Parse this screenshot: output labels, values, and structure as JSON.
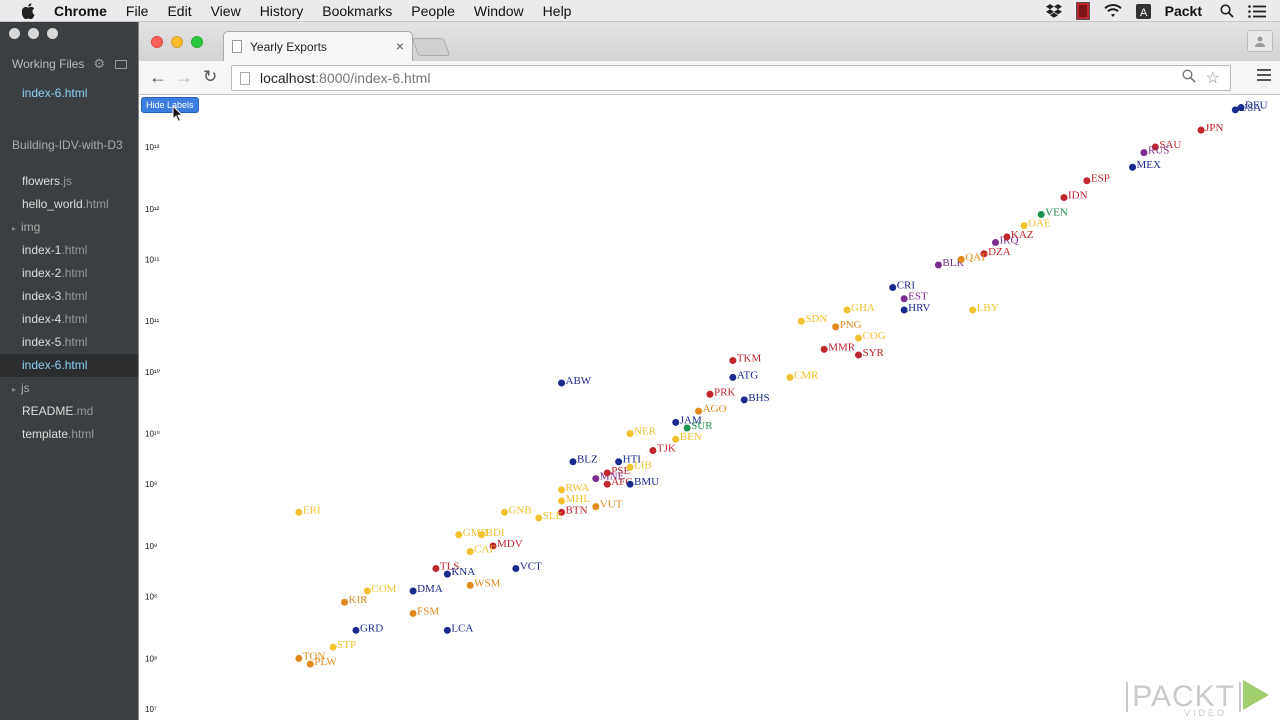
{
  "menubar": {
    "app": "Chrome",
    "items": [
      "File",
      "Edit",
      "View",
      "History",
      "Bookmarks",
      "People",
      "Window",
      "Help"
    ],
    "user": "Packt"
  },
  "editor": {
    "working_files_label": "Working Files",
    "working_file": "index-6.html",
    "project": "Building-IDV-with-D3",
    "tree": [
      {
        "name": "flowers",
        "ext": ".js",
        "type": "file"
      },
      {
        "name": "hello_world",
        "ext": ".html",
        "type": "file"
      },
      {
        "name": "img",
        "ext": "",
        "type": "folder"
      },
      {
        "name": "index-1",
        "ext": ".html",
        "type": "file"
      },
      {
        "name": "index-2",
        "ext": ".html",
        "type": "file"
      },
      {
        "name": "index-3",
        "ext": ".html",
        "type": "file"
      },
      {
        "name": "index-4",
        "ext": ".html",
        "type": "file"
      },
      {
        "name": "index-5",
        "ext": ".html",
        "type": "file"
      },
      {
        "name": "index-6",
        "ext": ".html",
        "type": "file",
        "active": true
      },
      {
        "name": "js",
        "ext": "",
        "type": "folder"
      },
      {
        "name": "README",
        "ext": ".md",
        "type": "file"
      },
      {
        "name": "template",
        "ext": ".html",
        "type": "file"
      }
    ]
  },
  "browser": {
    "tab_title": "Yearly Exports",
    "url_host": "localhost",
    "url_path": ":8000/index-6.html"
  },
  "page": {
    "hide_button": "Hide Labels"
  },
  "chart_data": {
    "type": "scatter",
    "y_scale": "log",
    "colors": [
      "#f2c12e",
      "#e08a1e",
      "#c0262d",
      "#7a2e8f",
      "#1a2a8c",
      "#1f8f4e"
    ],
    "y_ticks": [
      {
        "label": "10¹²",
        "v": 12.0
      },
      {
        "label": "10¹²",
        "v": 11.45
      },
      {
        "label": "10¹¹",
        "v": 11.0
      },
      {
        "label": "10¹¹",
        "v": 10.45
      },
      {
        "label": "10¹⁰",
        "v": 10.0
      },
      {
        "label": "10¹⁰",
        "v": 9.45
      },
      {
        "label": "10⁹",
        "v": 9.0
      },
      {
        "label": "10⁹",
        "v": 8.45
      },
      {
        "label": "10⁸",
        "v": 8.0
      },
      {
        "label": "10⁸",
        "v": 7.45
      },
      {
        "label": "10⁷",
        "v": 7.0
      }
    ],
    "points": [
      {
        "label": "DEU",
        "x": 0.965,
        "y": 12.35,
        "c": 4
      },
      {
        "label": "USA",
        "x": 0.96,
        "y": 12.33,
        "c": 4
      },
      {
        "label": "JPN",
        "x": 0.93,
        "y": 12.15,
        "c": 2
      },
      {
        "label": "SAU",
        "x": 0.89,
        "y": 12.0,
        "c": 2
      },
      {
        "label": "RUS",
        "x": 0.88,
        "y": 11.95,
        "c": 3
      },
      {
        "label": "MEX",
        "x": 0.87,
        "y": 11.82,
        "c": 4
      },
      {
        "label": "ESP",
        "x": 0.83,
        "y": 11.7,
        "c": 2
      },
      {
        "label": "IDN",
        "x": 0.81,
        "y": 11.55,
        "c": 2
      },
      {
        "label": "VEN",
        "x": 0.79,
        "y": 11.4,
        "c": 5
      },
      {
        "label": "OAE",
        "x": 0.775,
        "y": 11.3,
        "c": 0
      },
      {
        "label": "IRQ",
        "x": 0.75,
        "y": 11.15,
        "c": 3
      },
      {
        "label": "DZA",
        "x": 0.74,
        "y": 11.05,
        "c": 2
      },
      {
        "label": "KAZ",
        "x": 0.76,
        "y": 11.2,
        "c": 2
      },
      {
        "label": "BLR",
        "x": 0.7,
        "y": 10.95,
        "c": 3
      },
      {
        "label": "QAT",
        "x": 0.72,
        "y": 11.0,
        "c": 1
      },
      {
        "label": "EST",
        "x": 0.67,
        "y": 10.65,
        "c": 3
      },
      {
        "label": "HRV",
        "x": 0.67,
        "y": 10.55,
        "c": 4
      },
      {
        "label": "CRI",
        "x": 0.66,
        "y": 10.75,
        "c": 4
      },
      {
        "label": "LBY",
        "x": 0.73,
        "y": 10.55,
        "c": 0
      },
      {
        "label": "SDN",
        "x": 0.58,
        "y": 10.45,
        "c": 0
      },
      {
        "label": "GHA",
        "x": 0.62,
        "y": 10.55,
        "c": 0
      },
      {
        "label": "PNG",
        "x": 0.61,
        "y": 10.4,
        "c": 1
      },
      {
        "label": "COG",
        "x": 0.63,
        "y": 10.3,
        "c": 0
      },
      {
        "label": "SYR",
        "x": 0.63,
        "y": 10.15,
        "c": 2
      },
      {
        "label": "TKM",
        "x": 0.52,
        "y": 10.1,
        "c": 2
      },
      {
        "label": "MMR",
        "x": 0.6,
        "y": 10.2,
        "c": 2
      },
      {
        "label": "ATG",
        "x": 0.52,
        "y": 9.95,
        "c": 4
      },
      {
        "label": "CMR",
        "x": 0.57,
        "y": 9.95,
        "c": 0
      },
      {
        "label": "BHS",
        "x": 0.53,
        "y": 9.75,
        "c": 4
      },
      {
        "label": "PRK",
        "x": 0.5,
        "y": 9.8,
        "c": 2
      },
      {
        "label": "AGO",
        "x": 0.49,
        "y": 9.65,
        "c": 1
      },
      {
        "label": "JAM",
        "x": 0.47,
        "y": 9.55,
        "c": 4
      },
      {
        "label": "SUR",
        "x": 0.48,
        "y": 9.5,
        "c": 5
      },
      {
        "label": "BEN",
        "x": 0.47,
        "y": 9.4,
        "c": 0
      },
      {
        "label": "NER",
        "x": 0.43,
        "y": 9.45,
        "c": 0
      },
      {
        "label": "TJK",
        "x": 0.45,
        "y": 9.3,
        "c": 2
      },
      {
        "label": "ABW",
        "x": 0.37,
        "y": 9.9,
        "c": 4
      },
      {
        "label": "BLZ",
        "x": 0.38,
        "y": 9.2,
        "c": 4
      },
      {
        "label": "HTI",
        "x": 0.42,
        "y": 9.2,
        "c": 4
      },
      {
        "label": "MNE",
        "x": 0.4,
        "y": 9.05,
        "c": 3
      },
      {
        "label": "PSE",
        "x": 0.41,
        "y": 9.1,
        "c": 2
      },
      {
        "label": "LIB",
        "x": 0.43,
        "y": 9.15,
        "c": 0
      },
      {
        "label": "AFG",
        "x": 0.41,
        "y": 9.0,
        "c": 2
      },
      {
        "label": "BMU",
        "x": 0.43,
        "y": 9.0,
        "c": 4
      },
      {
        "label": "RWA",
        "x": 0.37,
        "y": 8.95,
        "c": 0
      },
      {
        "label": "MHL",
        "x": 0.37,
        "y": 8.85,
        "c": 0
      },
      {
        "label": "BTN",
        "x": 0.37,
        "y": 8.75,
        "c": 2
      },
      {
        "label": "VUT",
        "x": 0.4,
        "y": 8.8,
        "c": 1
      },
      {
        "label": "ERI",
        "x": 0.14,
        "y": 8.75,
        "c": 0
      },
      {
        "label": "GNB",
        "x": 0.32,
        "y": 8.75,
        "c": 0
      },
      {
        "label": "SLE",
        "x": 0.35,
        "y": 8.7,
        "c": 0
      },
      {
        "label": "GMB",
        "x": 0.28,
        "y": 8.55,
        "c": 0
      },
      {
        "label": "BDI",
        "x": 0.3,
        "y": 8.55,
        "c": 0
      },
      {
        "label": "MDV",
        "x": 0.31,
        "y": 8.45,
        "c": 2
      },
      {
        "label": "CAF",
        "x": 0.29,
        "y": 8.4,
        "c": 0
      },
      {
        "label": "TLS",
        "x": 0.26,
        "y": 8.25,
        "c": 2
      },
      {
        "label": "VCT",
        "x": 0.33,
        "y": 8.25,
        "c": 4
      },
      {
        "label": "KNA",
        "x": 0.27,
        "y": 8.2,
        "c": 4
      },
      {
        "label": "WSM",
        "x": 0.29,
        "y": 8.1,
        "c": 1
      },
      {
        "label": "DMA",
        "x": 0.24,
        "y": 8.05,
        "c": 4
      },
      {
        "label": "COM",
        "x": 0.2,
        "y": 8.05,
        "c": 0
      },
      {
        "label": "KIR",
        "x": 0.18,
        "y": 7.95,
        "c": 1
      },
      {
        "label": "FSM",
        "x": 0.24,
        "y": 7.85,
        "c": 1
      },
      {
        "label": "GRD",
        "x": 0.19,
        "y": 7.7,
        "c": 4
      },
      {
        "label": "LCA",
        "x": 0.27,
        "y": 7.7,
        "c": 4
      },
      {
        "label": "STP",
        "x": 0.17,
        "y": 7.55,
        "c": 0
      },
      {
        "label": "TON",
        "x": 0.14,
        "y": 7.45,
        "c": 1
      },
      {
        "label": "PLW",
        "x": 0.15,
        "y": 7.4,
        "c": 1
      }
    ]
  },
  "watermark": {
    "word": "PACKT",
    "sub": "VIDEO"
  }
}
